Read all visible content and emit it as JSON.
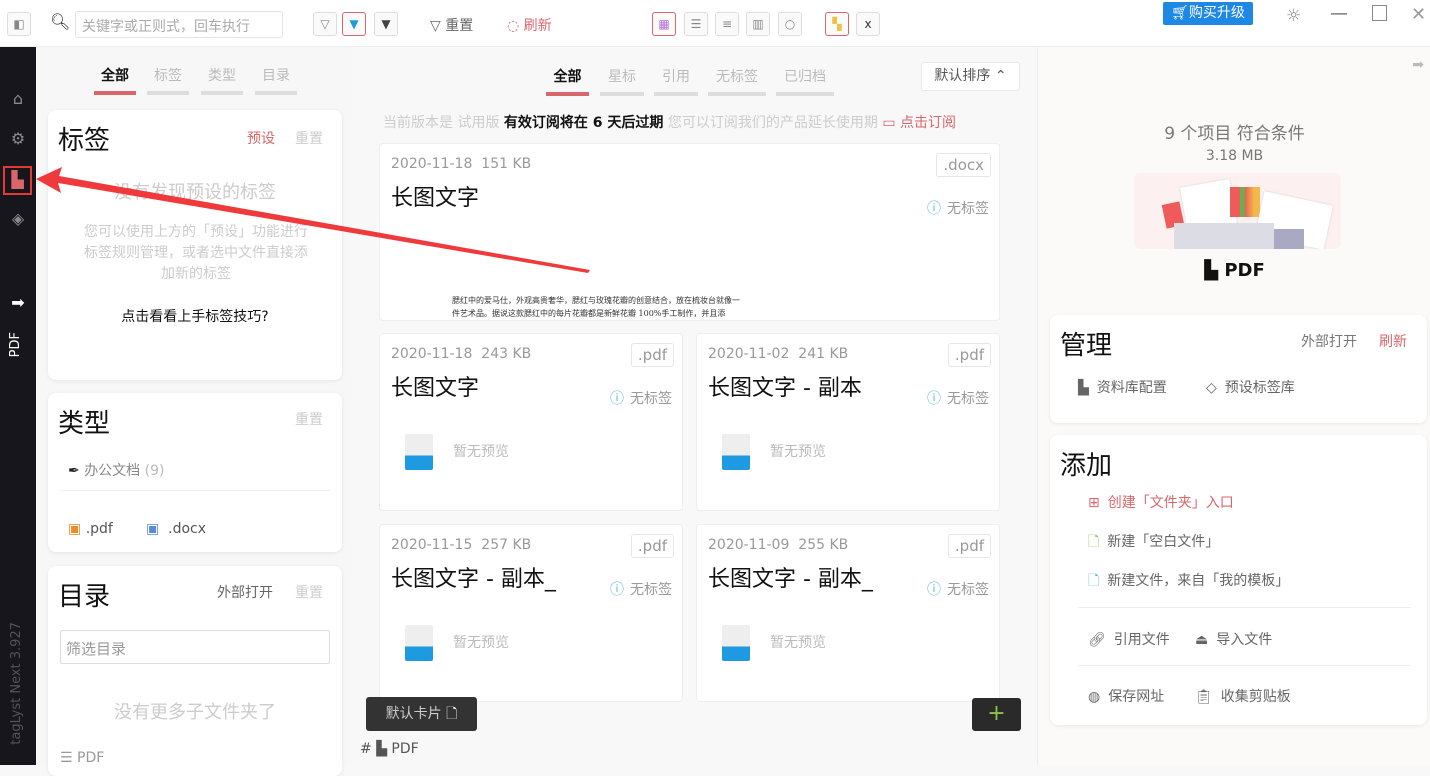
{
  "toolbar": {
    "search_placeholder": "关键字或正则式，回车执行",
    "reset": "重置",
    "refresh": "刷新",
    "buy": "购买升级"
  },
  "sidebar": {
    "version": "tagLyst Next 3.927",
    "library": "PDF"
  },
  "left": {
    "tabs": [
      "全部",
      "标签",
      "类型",
      "目录"
    ],
    "tags": {
      "title": "标签",
      "preset": "预设",
      "reset": "重置",
      "empty": "没有发现预设的标签",
      "hint": "您可以使用上方的「预设」功能进行标签规则管理，或者选中文件直接添加新的标签",
      "tip": "点击看看上手标签技巧?"
    },
    "types": {
      "title": "类型",
      "reset": "重置",
      "category": "办公文档",
      "count": "(9)",
      "exts": [
        ".pdf",
        ".docx"
      ]
    },
    "dirs": {
      "title": "目录",
      "open": "外部打开",
      "reset": "重置",
      "filter_placeholder": "筛选目录",
      "empty": "没有更多子文件夹了",
      "item": "PDF"
    }
  },
  "center": {
    "tabs": [
      "全部",
      "星标",
      "引用",
      "无标签",
      "已归档"
    ],
    "sort": "默认排序",
    "notice": {
      "pre": "当前版本是 试用版",
      "bold": "有效订阅将在 6 天后过期",
      "post": "您可以订阅我们的产品延长使用期",
      "link": "点击订阅"
    },
    "preview_text": "腮红中的爱马仕，外观高贵奢华，腮红与玫瑰花瓣的创意结合，放在梳妆台就像一件艺术品。据说这款腮红中的每片花瓣都是新鲜花瓣 100%手工制作，并且添",
    "no_tag": "无标签",
    "no_preview": "暂无预览",
    "files": [
      {
        "date": "2020-11-18",
        "size": "151 KB",
        "title": "长图文字",
        "ext": ".docx"
      },
      {
        "date": "2020-11-18",
        "size": "243 KB",
        "title": "长图文字",
        "ext": ".pdf"
      },
      {
        "date": "2020-11-02",
        "size": "241 KB",
        "title": "长图文字 - 副本",
        "ext": ".pdf"
      },
      {
        "date": "2020-11-15",
        "size": "257 KB",
        "title": "长图文字 - 副本_",
        "ext": ".pdf"
      },
      {
        "date": "2020-11-09",
        "size": "255 KB",
        "title": "长图文字 - 副本_",
        "ext": ".pdf"
      }
    ],
    "card_mode": "默认卡片",
    "path_hash": "#",
    "path": "PDF",
    "add": "+"
  },
  "right": {
    "count": "9 个项目 符合条件",
    "size": "3.18 MB",
    "library": "PDF",
    "manage": {
      "title": "管理",
      "open": "外部打开",
      "refresh": "刷新",
      "config": "资料库配置",
      "preset_tags": "预设标签库"
    },
    "add": {
      "title": "添加",
      "create_folder": "创建「文件夹」入口",
      "new_blank": "新建「空白文件」",
      "new_template": "新建文件，来自「我的模板」",
      "ref": "引用文件",
      "import": "导入文件",
      "save_url": "保存网址",
      "clipboard": "收集剪贴板"
    }
  },
  "colors": {
    "accent": "#d9666b",
    "sidebar": "#16161c",
    "buy": "#1e88e5"
  }
}
